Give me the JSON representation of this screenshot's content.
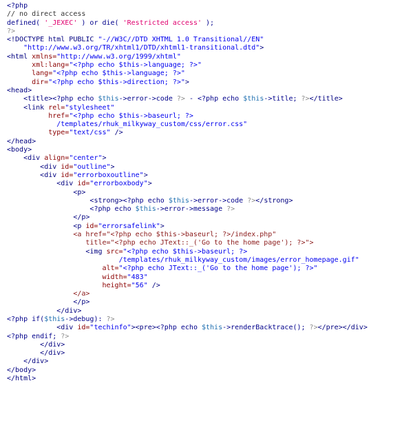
{
  "editor": {
    "language": "php",
    "lines": [
      [
        [
          "t-php",
          "<?php"
        ]
      ],
      [
        [
          "t-cmt",
          "// no direct access"
        ]
      ],
      [
        [
          "t-php",
          "defined( "
        ],
        [
          "t-str",
          "'_JEXEC'"
        ],
        [
          "t-php",
          " ) or die( "
        ],
        [
          "t-str",
          "'Restricted access'"
        ],
        [
          "t-php",
          " );"
        ]
      ],
      [
        [
          "t-phpd",
          "?>"
        ]
      ],
      [
        [
          "t-tag",
          "<!DOCTYPE html PUBLIC "
        ],
        [
          "t-val",
          "\"-//W3C//DTD XHTML 1.0 Transitional//EN\""
        ]
      ],
      [
        [
          "t-plain",
          "    "
        ],
        [
          "t-val",
          "\"http://www.w3.org/TR/xhtml1/DTD/xhtml1-transitional.dtd\""
        ],
        [
          "t-tag",
          ">"
        ]
      ],
      [
        [
          "t-tag",
          "<html "
        ],
        [
          "t-attr",
          "xmlns="
        ],
        [
          "t-val",
          "\"http://www.w3.org/1999/xhtml\""
        ]
      ],
      [
        [
          "t-plain",
          "      "
        ],
        [
          "t-attr",
          "xml:lang="
        ],
        [
          "t-val",
          "\"<?php echo $this->language; ?>\""
        ]
      ],
      [
        [
          "t-plain",
          "      "
        ],
        [
          "t-attr",
          "lang="
        ],
        [
          "t-val",
          "\"<?php echo $this->language; ?>\""
        ]
      ],
      [
        [
          "t-plain",
          "      "
        ],
        [
          "t-attr",
          "dir="
        ],
        [
          "t-val",
          "\"<?php echo $this->direction; ?>\""
        ],
        [
          "t-tag",
          ">"
        ]
      ],
      [
        [
          "t-tag",
          "<head>"
        ]
      ],
      [
        [
          "t-plain",
          "    "
        ],
        [
          "t-tag",
          "<title>"
        ],
        [
          "t-php",
          "<?php echo "
        ],
        [
          "t-var",
          "$this"
        ],
        [
          "t-php",
          "->error->code "
        ],
        [
          "t-phpd",
          "?>"
        ],
        [
          "t-php",
          " - <?php echo "
        ],
        [
          "t-var",
          "$this"
        ],
        [
          "t-php",
          "->title; "
        ],
        [
          "t-phpd",
          "?>"
        ],
        [
          "t-tag",
          "</title>"
        ]
      ],
      [
        [
          "t-plain",
          "    "
        ],
        [
          "t-tag",
          "<link "
        ],
        [
          "t-attr",
          "rel="
        ],
        [
          "t-val",
          "\"stylesheet\""
        ]
      ],
      [
        [
          "t-plain",
          "          "
        ],
        [
          "t-attr",
          "href="
        ],
        [
          "t-val",
          "\"<?php echo $this->baseurl; ?>"
        ]
      ],
      [
        [
          "t-plain",
          "            "
        ],
        [
          "t-val",
          "/templates/rhuk_milkyway_custom/css/error.css\""
        ]
      ],
      [
        [
          "t-plain",
          "          "
        ],
        [
          "t-attr",
          "type="
        ],
        [
          "t-val",
          "\"text/css\""
        ],
        [
          "t-tag",
          " />"
        ]
      ],
      [
        [
          "t-tag",
          "</head>"
        ]
      ],
      [
        [
          "t-tag",
          "<body>"
        ]
      ],
      [
        [
          "t-plain",
          "    "
        ],
        [
          "t-tag",
          "<div "
        ],
        [
          "t-attr",
          "align="
        ],
        [
          "t-val",
          "\"center\""
        ],
        [
          "t-tag",
          ">"
        ]
      ],
      [
        [
          "t-plain",
          "        "
        ],
        [
          "t-tag",
          "<div "
        ],
        [
          "t-attr",
          "id="
        ],
        [
          "t-val",
          "\"outline\""
        ],
        [
          "t-tag",
          ">"
        ]
      ],
      [
        [
          "t-plain",
          "        "
        ],
        [
          "t-tag",
          "<div "
        ],
        [
          "t-attr",
          "id="
        ],
        [
          "t-val",
          "\"errorboxoutline\""
        ],
        [
          "t-tag",
          ">"
        ]
      ],
      [
        [
          "t-plain",
          "            "
        ],
        [
          "t-tag",
          "<div "
        ],
        [
          "t-attr",
          "id="
        ],
        [
          "t-val",
          "\"errorboxbody\""
        ],
        [
          "t-tag",
          ">"
        ]
      ],
      [
        [
          "t-plain",
          "                "
        ],
        [
          "t-tag",
          "<p>"
        ]
      ],
      [
        [
          "t-plain",
          "                    "
        ],
        [
          "t-tag",
          "<strong>"
        ],
        [
          "t-php",
          "<?php echo "
        ],
        [
          "t-var",
          "$this"
        ],
        [
          "t-php",
          "->error->code "
        ],
        [
          "t-phpd",
          "?>"
        ],
        [
          "t-tag",
          "</strong>"
        ]
      ],
      [
        [
          "t-plain",
          "                    "
        ],
        [
          "t-php",
          "<?php echo "
        ],
        [
          "t-var",
          "$this"
        ],
        [
          "t-php",
          "->error->message "
        ],
        [
          "t-phpd",
          "?>"
        ]
      ],
      [
        [
          "t-plain",
          "                "
        ],
        [
          "t-tag",
          "</p>"
        ]
      ],
      [
        [
          "t-plain",
          "                "
        ],
        [
          "t-tag",
          "<p "
        ],
        [
          "t-attr",
          "id="
        ],
        [
          "t-val",
          "\"errorsafelink\""
        ],
        [
          "t-tag",
          ">"
        ]
      ],
      [
        [
          "t-plain",
          "                "
        ],
        [
          "t-anchor",
          "<a href=\"<?php echo $this->baseurl; ?>/index.php\""
        ]
      ],
      [
        [
          "t-plain",
          "                   "
        ],
        [
          "t-anchor",
          "title=\"<?php echo JText::_('Go to the home page'); ?>\">"
        ]
      ],
      [
        [
          "t-plain",
          "                   "
        ],
        [
          "t-tag",
          "<img "
        ],
        [
          "t-attr",
          "src="
        ],
        [
          "t-val",
          "\"<?php echo $this->baseurl; ?>"
        ]
      ],
      [
        [
          "t-plain",
          "                           "
        ],
        [
          "t-val",
          "/templates/rhuk_milkyway_custom/images/error_homepage.gif\""
        ]
      ],
      [
        [
          "t-plain",
          "                       "
        ],
        [
          "t-attr",
          "alt="
        ],
        [
          "t-val",
          "\"<?php echo JText::_('Go to the home page'); ?>\""
        ]
      ],
      [
        [
          "t-plain",
          "                       "
        ],
        [
          "t-attr",
          "width="
        ],
        [
          "t-val",
          "\"483\""
        ]
      ],
      [
        [
          "t-plain",
          "                       "
        ],
        [
          "t-attr",
          "height="
        ],
        [
          "t-val",
          "\"56\""
        ],
        [
          "t-tag",
          " />"
        ]
      ],
      [
        [
          "t-plain",
          "                "
        ],
        [
          "t-anchor",
          "</a>"
        ]
      ],
      [
        [
          "t-plain",
          "                "
        ],
        [
          "t-tag",
          "</p>"
        ]
      ],
      [
        [
          "t-plain",
          "            "
        ],
        [
          "t-tag",
          "</div>"
        ]
      ],
      [
        [
          "t-php",
          "<?php if("
        ],
        [
          "t-var",
          "$this"
        ],
        [
          "t-php",
          "->debug): "
        ],
        [
          "t-phpd",
          "?>"
        ]
      ],
      [
        [
          "t-plain",
          "            "
        ],
        [
          "t-tag",
          "<div "
        ],
        [
          "t-attr",
          "id="
        ],
        [
          "t-val",
          "\"techinfo\""
        ],
        [
          "t-tag",
          "><pre>"
        ],
        [
          "t-php",
          "<?php echo "
        ],
        [
          "t-var",
          "$this"
        ],
        [
          "t-php",
          "->renderBacktrace(); "
        ],
        [
          "t-phpd",
          "?>"
        ],
        [
          "t-tag",
          "</pre></div>"
        ]
      ],
      [
        [
          "t-php",
          "<?php endif; "
        ],
        [
          "t-phpd",
          "?>"
        ]
      ],
      [
        [
          "t-plain",
          "        "
        ],
        [
          "t-tag",
          "</div>"
        ]
      ],
      [
        [
          "t-plain",
          "        "
        ],
        [
          "t-tag",
          "</div>"
        ]
      ],
      [
        [
          "t-plain",
          "    "
        ],
        [
          "t-tag",
          "</div>"
        ]
      ],
      [
        [
          "t-tag",
          "</body>"
        ]
      ],
      [
        [
          "t-tag",
          "</html>"
        ]
      ]
    ]
  }
}
